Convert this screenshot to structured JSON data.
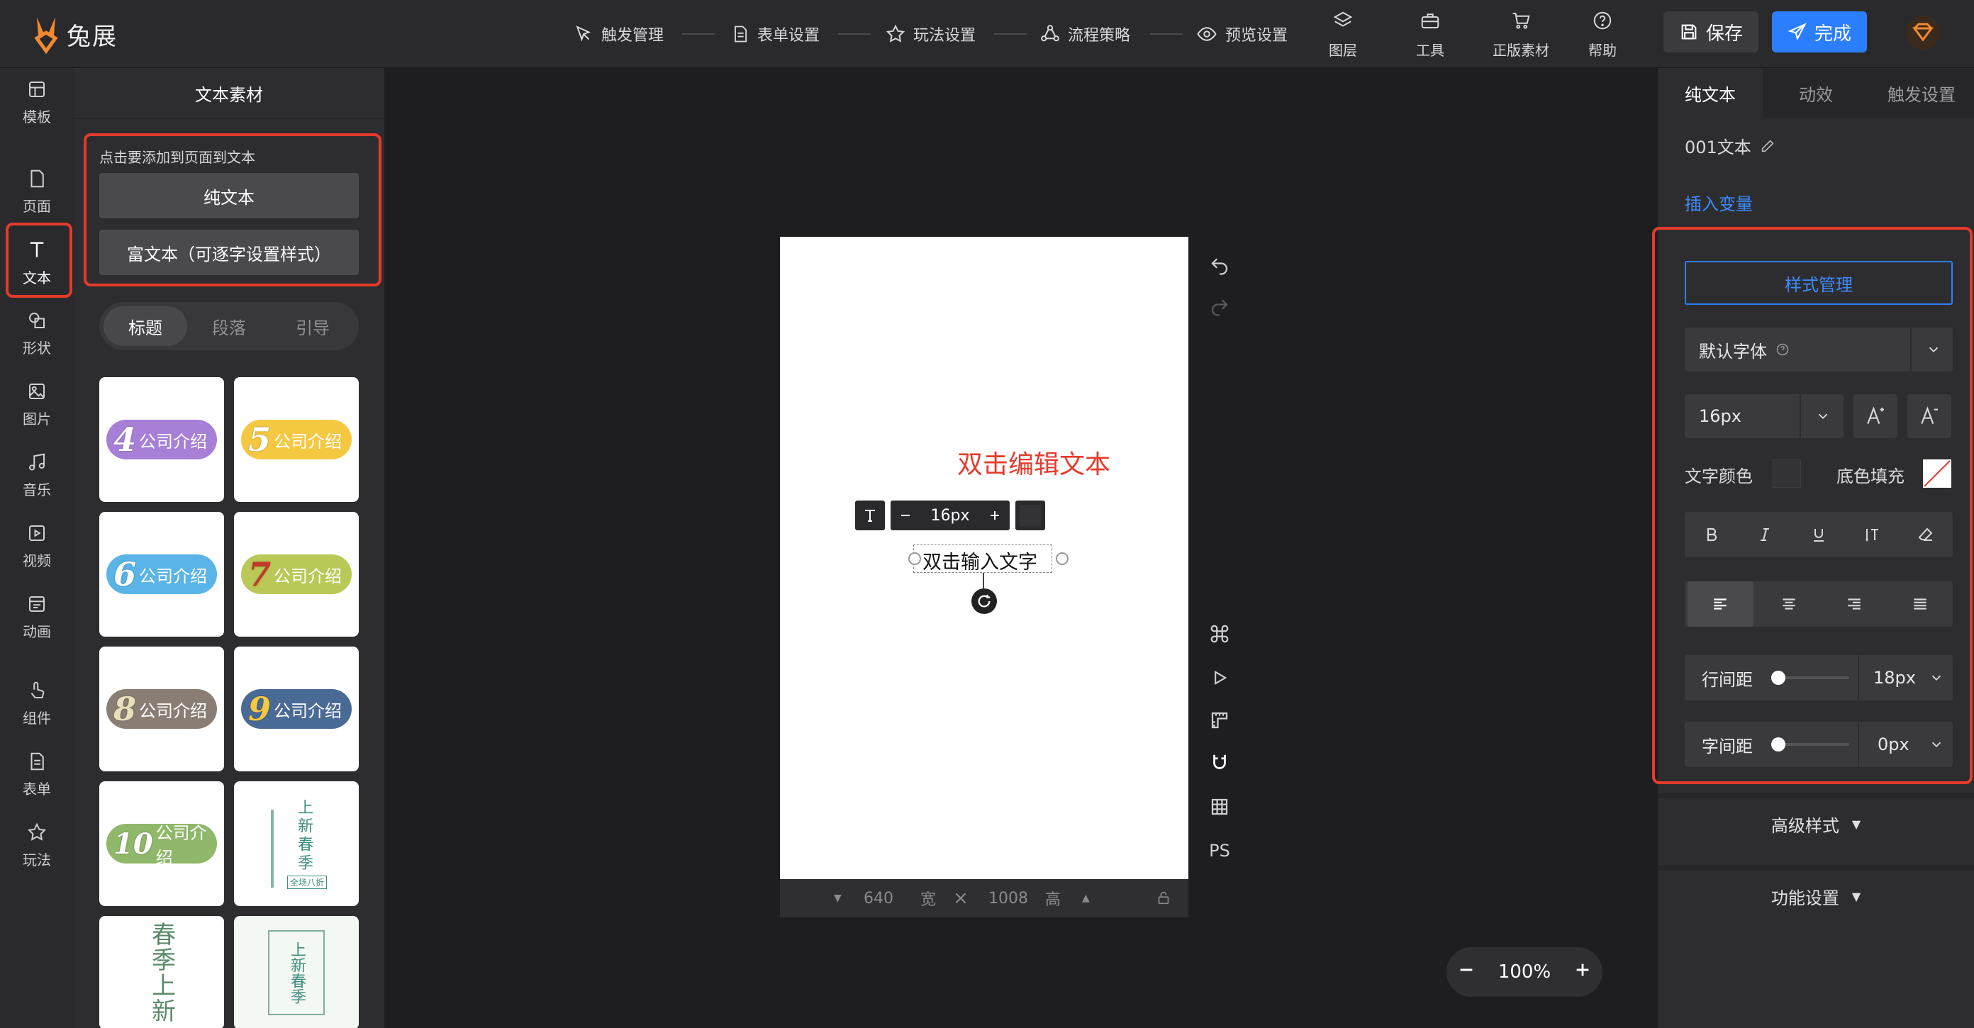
{
  "app": {
    "name": "兔展"
  },
  "steps": [
    {
      "label": "触发管理",
      "icon": "trigger-icon"
    },
    {
      "label": "表单设置",
      "icon": "form-icon"
    },
    {
      "label": "玩法设置",
      "icon": "star-icon"
    },
    {
      "label": "流程策略",
      "icon": "flow-icon"
    },
    {
      "label": "预览设置",
      "icon": "eye-icon"
    }
  ],
  "tools": [
    {
      "label": "图层",
      "icon": "layers-icon"
    },
    {
      "label": "工具",
      "icon": "toolbox-icon"
    },
    {
      "label": "正版素材",
      "icon": "cart-icon"
    },
    {
      "label": "帮助",
      "icon": "help-icon"
    }
  ],
  "actions": {
    "save": "保存",
    "done": "完成"
  },
  "leftnav": [
    {
      "label": "模板",
      "icon": "template-icon"
    },
    {
      "label": "页面",
      "icon": "page-icon"
    },
    {
      "label": "文本",
      "icon": "text-icon",
      "active": true
    },
    {
      "label": "形状",
      "icon": "shape-icon"
    },
    {
      "label": "图片",
      "icon": "image-icon"
    },
    {
      "label": "音乐",
      "icon": "music-icon"
    },
    {
      "label": "视频",
      "icon": "video-icon"
    },
    {
      "label": "动画",
      "icon": "animation-icon"
    },
    {
      "label": "组件",
      "icon": "component-icon"
    },
    {
      "label": "表单",
      "icon": "form-list-icon"
    },
    {
      "label": "玩法",
      "icon": "play-icon"
    }
  ],
  "leftpanel": {
    "title": "文本素材",
    "hint": "点击要添加到页面到文本",
    "plain_text_btn": "纯文本",
    "rich_text_btn": "富文本（可逐字设置样式）",
    "tabs": [
      "标题",
      "段落",
      "引导"
    ],
    "active_tab": "标题",
    "tiles": [
      {
        "num": "4",
        "text": "公司介绍",
        "color": "#a77fd6"
      },
      {
        "num": "5",
        "text": "公司介绍",
        "color": "#f5c842"
      },
      {
        "num": "6",
        "text": "公司介绍",
        "color": "#5ab4e8"
      },
      {
        "num": "7",
        "text": "公司介绍",
        "color": "#b9c857"
      },
      {
        "num": "8",
        "text": "公司介绍",
        "color": "#8a7e74"
      },
      {
        "num": "9",
        "text": "公司介绍",
        "color": "#4a6a96"
      },
      {
        "num": "10",
        "text": "公司介绍",
        "color": "#8fb86a"
      },
      {
        "text": "上新春季",
        "small": "全场八折"
      },
      {
        "text": "春季上新"
      },
      {
        "text": "上新春季"
      }
    ]
  },
  "canvas": {
    "annotation": "双击编辑文本",
    "placeholder_text": "双击输入文字",
    "toolbar_size": "16px",
    "width": "640",
    "width_label": "宽",
    "height": "1008",
    "height_label": "高",
    "side_tool_ps": "PS",
    "zoom": "100%"
  },
  "rightpanel": {
    "tabs": [
      "纯文本",
      "动效",
      "触发设置"
    ],
    "active_tab": "纯文本",
    "element_name": "001文本",
    "insert_var": "插入变量",
    "style_manage": "样式管理",
    "font": "默认字体",
    "font_size": "16px",
    "text_color_label": "文字颜色",
    "bg_fill_label": "底色填充",
    "line_height_label": "行间距",
    "line_height": "18px",
    "letter_spacing_label": "字间距",
    "letter_spacing": "0px",
    "advanced_style": "高级样式",
    "function_settings": "功能设置"
  },
  "colors": {
    "accent": "#2b7fff",
    "highlight": "#e53b2c",
    "annotation": "#e53b2c"
  }
}
